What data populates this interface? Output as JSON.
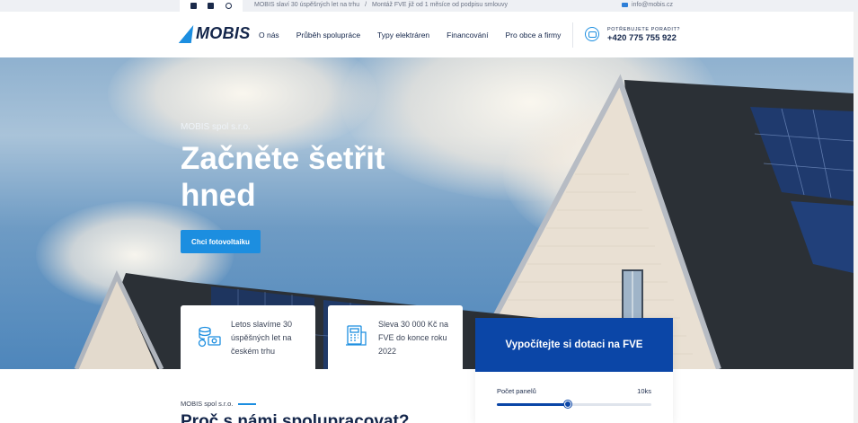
{
  "topbar": {
    "message_1": "MOBIS slaví 30 úspěšných let na trhu",
    "separator": "/",
    "message_2": "Montáž FVE již od 1 měsíce od podpisu smlouvy",
    "email": "info@mobis.cz",
    "social_icons": [
      "facebook-icon",
      "linkedin-icon",
      "instagram-icon"
    ]
  },
  "nav": {
    "logo_text": "MOBIS",
    "items": [
      "O nás",
      "Průběh spolupráce",
      "Typy elektráren",
      "Financování",
      "Pro obce a firmy"
    ],
    "phone_label": "POTŘEBUJETE PORADIT?",
    "phone_number": "+420 775 755 922"
  },
  "hero": {
    "company": "MOBIS spol s.r.o.",
    "title": "Začněte šetřit hned",
    "cta": "Chci fotovoltaiku"
  },
  "cards": [
    {
      "icon": "coins-money-icon",
      "text": "Letos slavíme 30 úspěšných let na českém trhu"
    },
    {
      "icon": "cash-register-icon",
      "text": "Sleva 30 000 Kč na FVE do konce roku 2022"
    }
  ],
  "calculator": {
    "title": "Vypočítejte si dotaci na FVE",
    "slider_label": "Počet panelů",
    "slider_value": "10ks",
    "slider_fraction": 0.46
  },
  "section": {
    "subtitle": "MOBIS spol s.r.o.",
    "title": "Proč s námi spolupracovat?"
  },
  "colors": {
    "accent": "#1c8ee0",
    "navy": "#13254a",
    "calc_header": "#0b46a7"
  }
}
